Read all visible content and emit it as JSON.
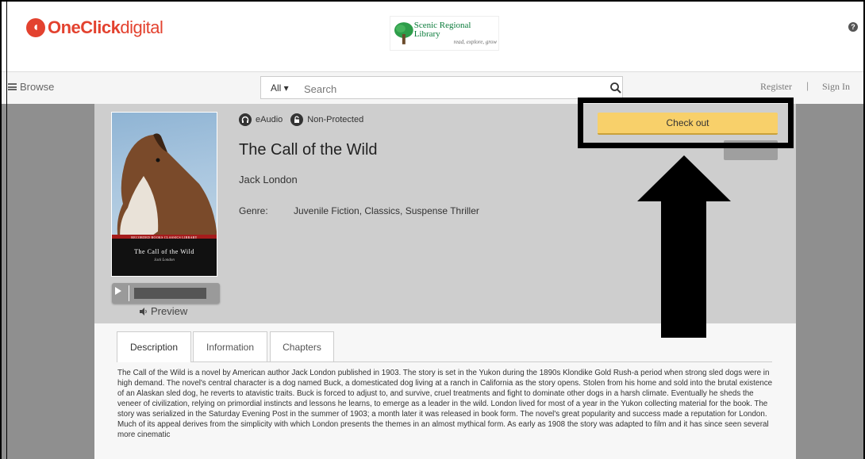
{
  "header": {
    "logo_bold": "OneClick",
    "logo_light": "digital",
    "library_name": "Scenic Regional Library",
    "library_tagline": "read, explore, grow",
    "help_symbol": "?"
  },
  "nav": {
    "browse_label": "Browse",
    "search_category": "All ▾",
    "search_placeholder": "Search",
    "register_label": "Register",
    "separator": "|",
    "signin_label": "Sign In"
  },
  "book": {
    "cover": {
      "series_text": "RECORDED BOOKS CLASSICS LIBRARY",
      "title_text": "The Call of the Wild",
      "author_text": "Jack London"
    },
    "format_label": "eAudio",
    "protection_label": "Non-Protected",
    "title": "The Call of the Wild",
    "author": "Jack London",
    "genre_label": "Genre:",
    "genre_value": "Juvenile Fiction, Classics, Suspense Thriller",
    "preview_label": "Preview",
    "checkout_label": "Check out"
  },
  "tabs": [
    {
      "label": "Description"
    },
    {
      "label": "Information"
    },
    {
      "label": "Chapters"
    }
  ],
  "description": "The Call of the Wild is a novel by American author Jack London published in 1903. The story is set in the Yukon during the 1890s Klondike Gold Rush-a period when strong sled dogs were in high demand. The novel's central character is a dog named Buck, a domesticated dog living at a ranch in California as the story opens. Stolen from his home and sold into the brutal existence of an Alaskan sled dog, he reverts to atavistic traits. Buck is forced to adjust to, and survive, cruel treatments and fight to dominate other dogs in a harsh climate. Eventually he sheds the veneer of civilization, relying on primordial instincts and lessons he learns, to emerge as a leader in the wild. London lived for most of a year in the Yukon collecting material for the book. The story was serialized in the Saturday Evening Post in the summer of 1903; a month later it was released in book form. The novel's great popularity and success made a reputation for London. Much of its appeal derives from the simplicity with which London presents the themes in an almost mythical form. As early as 1908 the story was adapted to film and it has since seen several more cinematic",
  "colors": {
    "brand": "#e3422f",
    "checkout": "#f8d06a",
    "hero_bg": "#cecece",
    "overlay": "#8f8f8f"
  }
}
